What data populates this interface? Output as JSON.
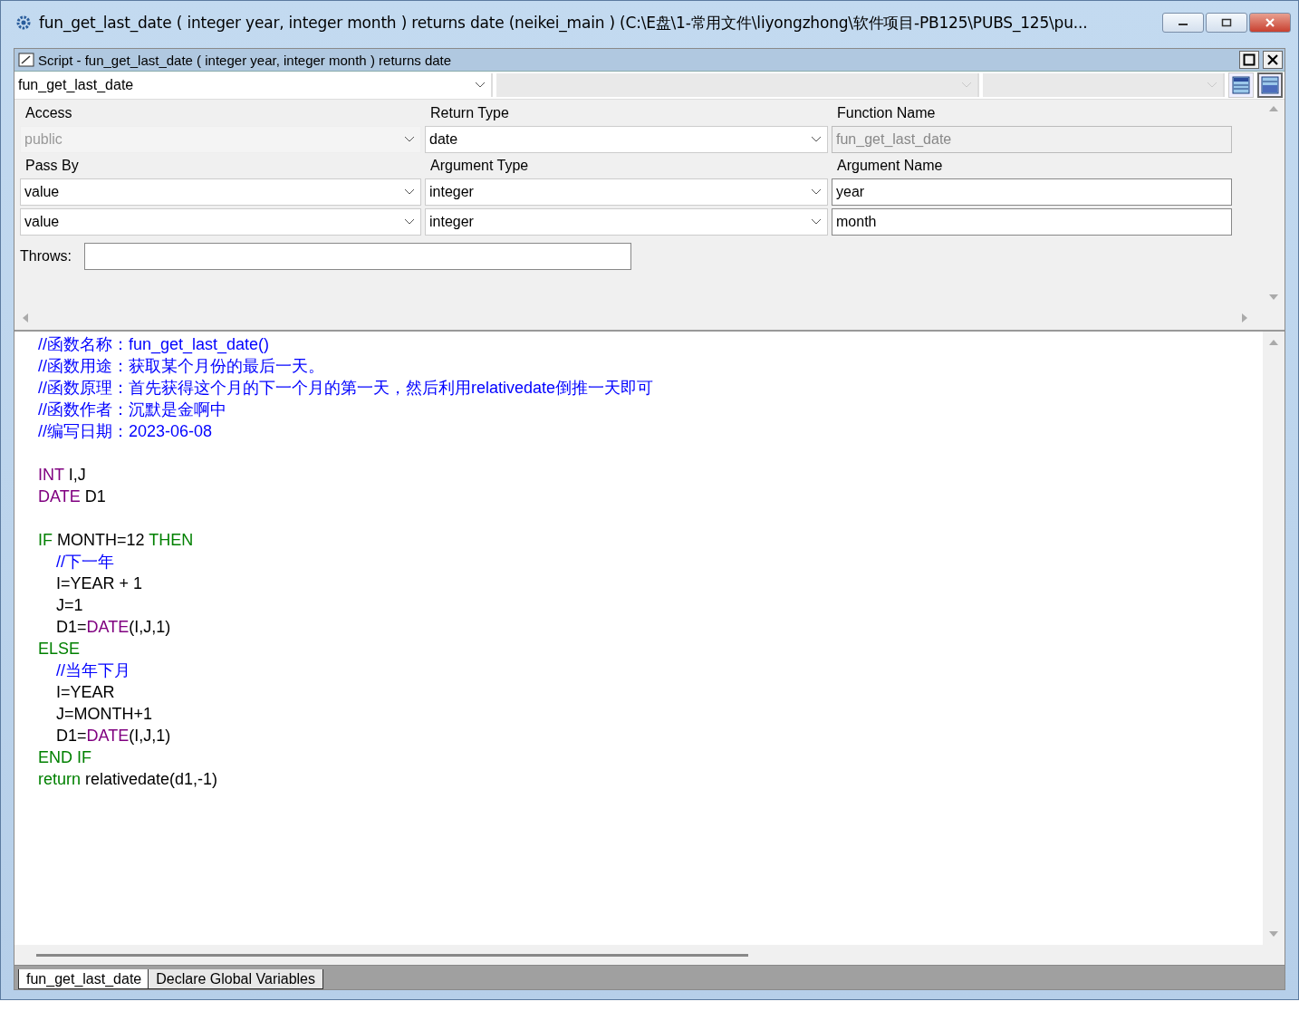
{
  "window": {
    "title": "fun_get_last_date ( integer year, integer month )  returns date (neikei_main ) (C:\\E盘\\1-常用文件\\liyongzhong\\软件项目-PB125\\PUBS_125\\pu..."
  },
  "script_window": {
    "title": "Script - fun_get_last_date ( integer year, integer month )  returns date"
  },
  "selectors": [
    {
      "value": "fun_get_last_date",
      "disabled": false
    },
    {
      "disabled": true
    },
    {
      "disabled": true
    }
  ],
  "form": {
    "labels": [
      "Access",
      "Return Type",
      "Function Name"
    ],
    "access": {
      "value": "public",
      "disabled": true
    },
    "return_type": {
      "value": "date",
      "disabled": false
    },
    "function_name": {
      "value": "fun_get_last_date",
      "disabled": true
    },
    "arg_labels": [
      "Pass By",
      "Argument Type",
      "Argument Name"
    ],
    "arguments": [
      {
        "pass_by": "value",
        "type": "integer",
        "name": "year"
      },
      {
        "pass_by": "value",
        "type": "integer",
        "name": "month"
      }
    ],
    "throws_label": "Throws:"
  },
  "code": [
    {
      "kind": "code",
      "tokens": [
        {
          "kind": "comment",
          "text": "//函数名称：fun_get_last_date()"
        }
      ]
    },
    {
      "kind": "code",
      "tokens": [
        {
          "kind": "comment",
          "text": "//函数用途：获取某个月份的最后一天。"
        }
      ]
    },
    {
      "kind": "code",
      "tokens": [
        {
          "kind": "comment",
          "text": "//函数原理：首先获得这个月的下一个月的第一天，然后利用relativedate倒推一天即可"
        }
      ]
    },
    {
      "kind": "code",
      "tokens": [
        {
          "kind": "comment",
          "text": "//函数作者：沉默是金啊中"
        }
      ]
    },
    {
      "kind": "code",
      "tokens": [
        {
          "kind": "comment",
          "text": "//编写日期：2023-06-08"
        }
      ]
    },
    {
      "kind": "blank"
    },
    {
      "kind": "code",
      "tokens": [
        {
          "kind": "type",
          "text": "INT"
        },
        {
          "kind": "plain",
          "text": " I,J"
        }
      ]
    },
    {
      "kind": "code",
      "tokens": [
        {
          "kind": "type",
          "text": "DATE"
        },
        {
          "kind": "plain",
          "text": " D1"
        }
      ]
    },
    {
      "kind": "blank"
    },
    {
      "kind": "code",
      "tokens": [
        {
          "kind": "keyword",
          "text": "IF"
        },
        {
          "kind": "plain",
          "text": " MONTH=12 "
        },
        {
          "kind": "keyword",
          "text": "THEN"
        }
      ]
    },
    {
      "kind": "code",
      "tokens": [
        {
          "kind": "comment",
          "text": "    //下一年"
        }
      ]
    },
    {
      "kind": "code",
      "tokens": [
        {
          "kind": "plain",
          "text": "    I=YEAR + 1"
        }
      ]
    },
    {
      "kind": "code",
      "tokens": [
        {
          "kind": "plain",
          "text": "    J=1"
        }
      ]
    },
    {
      "kind": "code",
      "tokens": [
        {
          "kind": "plain",
          "text": "    D1="
        },
        {
          "kind": "type",
          "text": "DATE"
        },
        {
          "kind": "plain",
          "text": "(I,J,1)"
        }
      ]
    },
    {
      "kind": "code",
      "tokens": [
        {
          "kind": "keyword",
          "text": "ELSE"
        }
      ]
    },
    {
      "kind": "code",
      "tokens": [
        {
          "kind": "comment",
          "text": "    //当年下月"
        }
      ]
    },
    {
      "kind": "code",
      "tokens": [
        {
          "kind": "plain",
          "text": "    I=YEAR"
        }
      ]
    },
    {
      "kind": "code",
      "tokens": [
        {
          "kind": "plain",
          "text": "    J=MONTH+1"
        }
      ]
    },
    {
      "kind": "code",
      "tokens": [
        {
          "kind": "plain",
          "text": "    D1="
        },
        {
          "kind": "type",
          "text": "DATE"
        },
        {
          "kind": "plain",
          "text": "(I,J,1)"
        }
      ]
    },
    {
      "kind": "code",
      "tokens": [
        {
          "kind": "keyword",
          "text": "END IF"
        }
      ]
    },
    {
      "kind": "code",
      "tokens": [
        {
          "kind": "keyword",
          "text": "return"
        },
        {
          "kind": "plain",
          "text": " relativedate(d1,-1)"
        }
      ]
    }
  ],
  "tabs": [
    {
      "label": "fun_get_last_date",
      "selected": true
    },
    {
      "label": "Declare Global Variables",
      "selected": false
    }
  ]
}
